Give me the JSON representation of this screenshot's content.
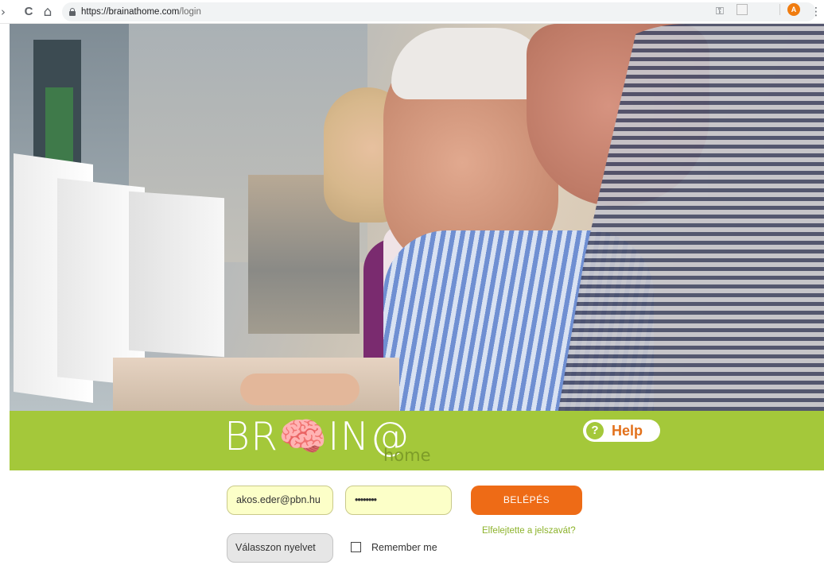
{
  "browser": {
    "back_icon": "chevron-back-icon",
    "reload_glyph": "C",
    "home_glyph": "⌂",
    "url_host": "https://brainathome.com",
    "url_path": "/login",
    "key_glyph": "⚿",
    "star_glyph": "☆",
    "profile_initial": "A",
    "menu_glyph": "⋮"
  },
  "hero": {
    "image_icon": "photo-seniors-at-computers"
  },
  "header": {
    "logo_text": "BR🧠IN@",
    "logo_sub": "home",
    "help_icon": "?",
    "help_label": "Help",
    "band_color": "#a4c83a"
  },
  "login": {
    "email_value": "akos.eder@pbn.hu",
    "password_value": "••••••••",
    "login_button": "BELÉPÉS",
    "forgot_link": "Elfelejtette a jelszavát?",
    "language_select": "Válasszon nyelvet",
    "remember_label": "Remember me",
    "accent_color": "#ee6b16"
  }
}
